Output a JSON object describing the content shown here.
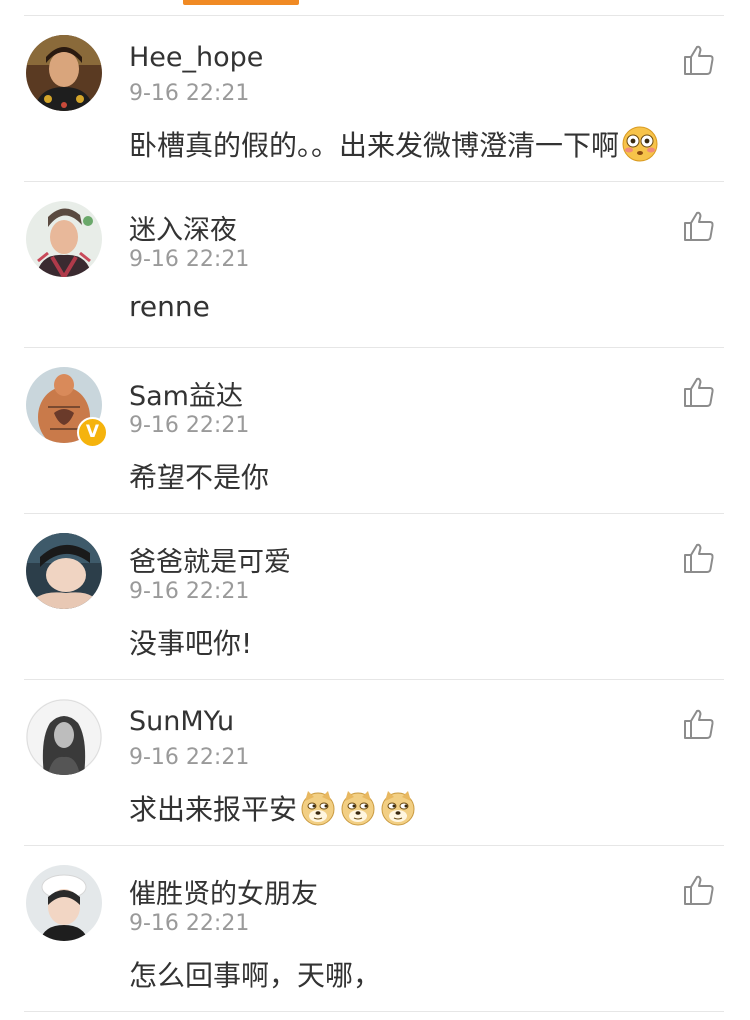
{
  "tabs": {
    "active_indicator_color": "#f08a24"
  },
  "comments": [
    {
      "username": "Hee_hope",
      "time": "9-16 22:21",
      "text": "卧槽真的假的。。出来发微博澄清一下啊",
      "emojis": [
        "flushed-face-emoji"
      ],
      "verified": false,
      "avatar": "avatar-hee-hope"
    },
    {
      "username": "迷入深夜",
      "time": "9-16 22:21",
      "text": "renne",
      "emojis": [],
      "verified": false,
      "avatar": "avatar-mi-ru-shen-ye"
    },
    {
      "username": "Sam益达",
      "time": "9-16 22:21",
      "text": "希望不是你",
      "emojis": [],
      "verified": true,
      "verified_badge": "V",
      "avatar": "avatar-sam-yida"
    },
    {
      "username": "爸爸就是可爱",
      "time": "9-16 22:21",
      "text": "没事吧你!",
      "emojis": [],
      "verified": false,
      "avatar": "avatar-baba-keai"
    },
    {
      "username": "SunMYu",
      "time": "9-16 22:21",
      "text": "求出来报平安",
      "emojis": [
        "doge-emoji",
        "doge-emoji",
        "doge-emoji"
      ],
      "verified": false,
      "avatar": "avatar-sunmyu"
    },
    {
      "username": "催胜贤的女朋友",
      "time": "9-16 22:21",
      "text": "怎么回事啊，天哪，",
      "emojis": [],
      "verified": false,
      "avatar": "avatar-cui-shengxian-nvpengyou"
    }
  ],
  "icons": {
    "like": "thumbs-up-icon"
  }
}
